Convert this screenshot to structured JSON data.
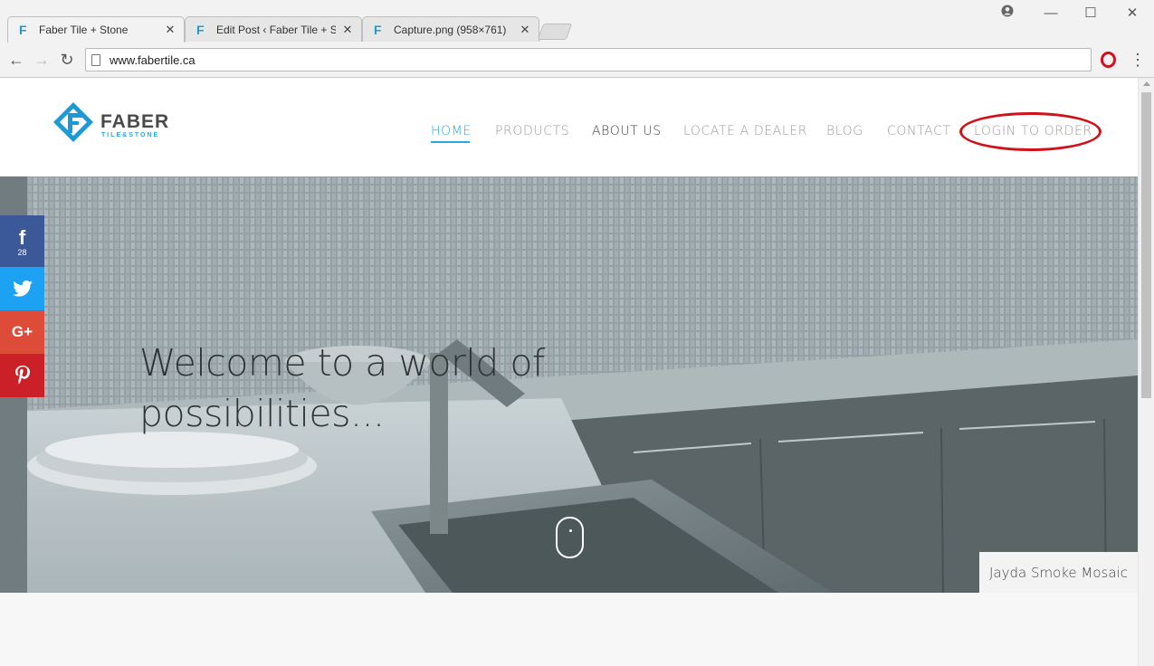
{
  "browser": {
    "tabs": [
      {
        "title": "Faber Tile + Stone",
        "active": true
      },
      {
        "title": "Edit Post ‹ Faber Tile + St",
        "active": false
      },
      {
        "title": "Capture.png (958×761)",
        "active": false
      }
    ],
    "favicon_glyph": "F",
    "close_glyph": "✕",
    "url": "www.fabertile.ca",
    "window_controls": {
      "minimize": "—",
      "maximize": "☐",
      "close": "✕"
    }
  },
  "site": {
    "logo": {
      "brand": "FABER",
      "sub": "TILE&STONE"
    },
    "nav": [
      {
        "label": "HOME",
        "state": "active"
      },
      {
        "label": "PRODUCTS",
        "state": "normal"
      },
      {
        "label": "ABOUT US",
        "state": "dark"
      },
      {
        "label": "LOCATE A DEALER",
        "state": "normal"
      },
      {
        "label": "BLOG",
        "state": "normal"
      },
      {
        "label": "CONTACT",
        "state": "normal"
      },
      {
        "label": "LOGIN TO ORDER",
        "state": "normal"
      }
    ],
    "hero": {
      "heading_line1": "Welcome to a world of",
      "heading_line2": "possibilities...",
      "caption": "Jayda Smoke Mosaic"
    },
    "social": {
      "facebook": {
        "icon": "facebook-icon",
        "count": "28"
      },
      "twitter": {
        "icon": "twitter-icon"
      },
      "googleplus": {
        "icon": "google-plus-icon",
        "label": "G+"
      },
      "pinterest": {
        "icon": "pinterest-icon"
      }
    },
    "colors": {
      "accent": "#29a8e0",
      "annotation": "#d0121b"
    }
  }
}
